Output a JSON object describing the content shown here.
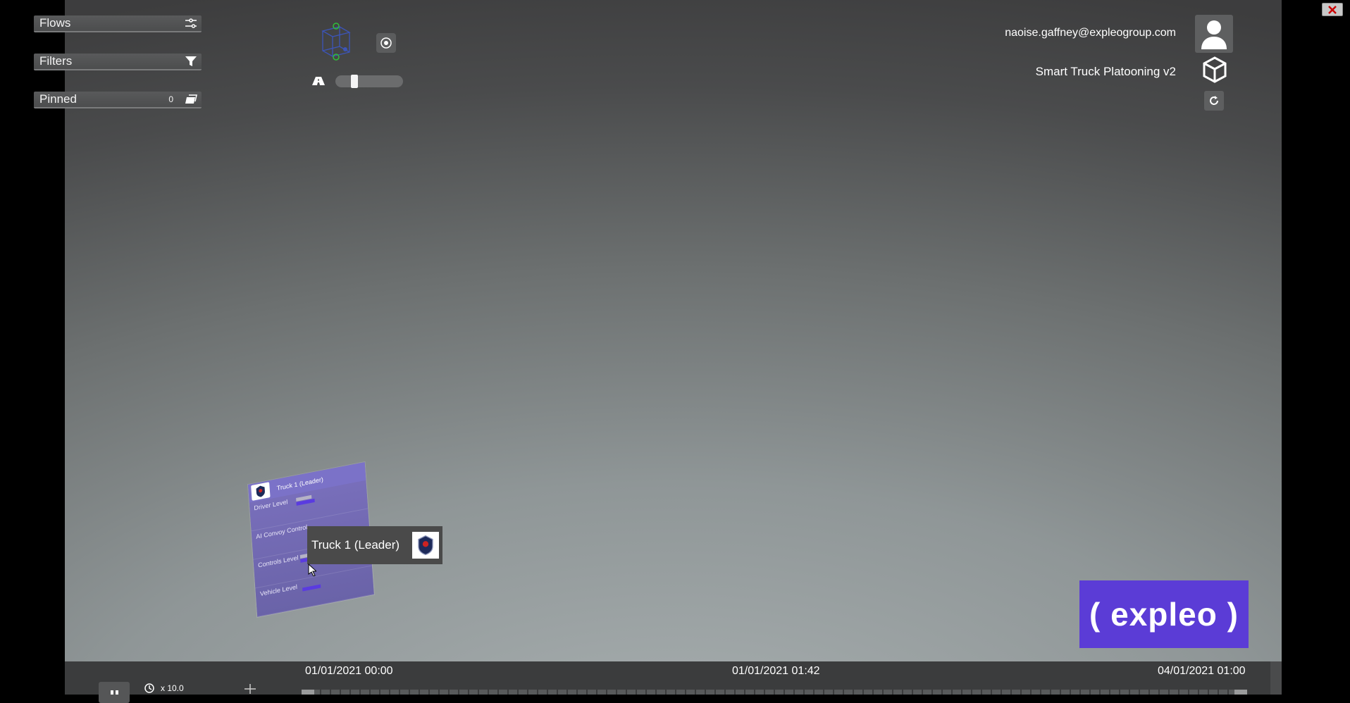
{
  "panels": {
    "flows": {
      "label": "Flows",
      "icon": "flows-icon"
    },
    "filters": {
      "label": "Filters",
      "icon": "filter-icon"
    },
    "pinned": {
      "label": "Pinned",
      "count": "0",
      "icon": "pinned-icon"
    }
  },
  "header": {
    "user_email": "naoise.gaffney@expleogroup.com",
    "project_name": "Smart Truck Platooning v2"
  },
  "node": {
    "title": "Truck 1 (Leader)",
    "rows": [
      "Driver Level",
      "AI Convoy Control",
      "Controls Level",
      "Vehicle Level"
    ]
  },
  "tooltip": {
    "label": "Truck 1 (Leader)"
  },
  "brand": {
    "text": "( expleo )"
  },
  "timeline": {
    "start": "01/01/2021 00:00",
    "current": "01/01/2021 01:42",
    "end": "04/01/2021 01:00",
    "speed": "x 10.0"
  },
  "colors": {
    "accent": "#5b3cd6",
    "node_bg": "#7a70bd"
  }
}
